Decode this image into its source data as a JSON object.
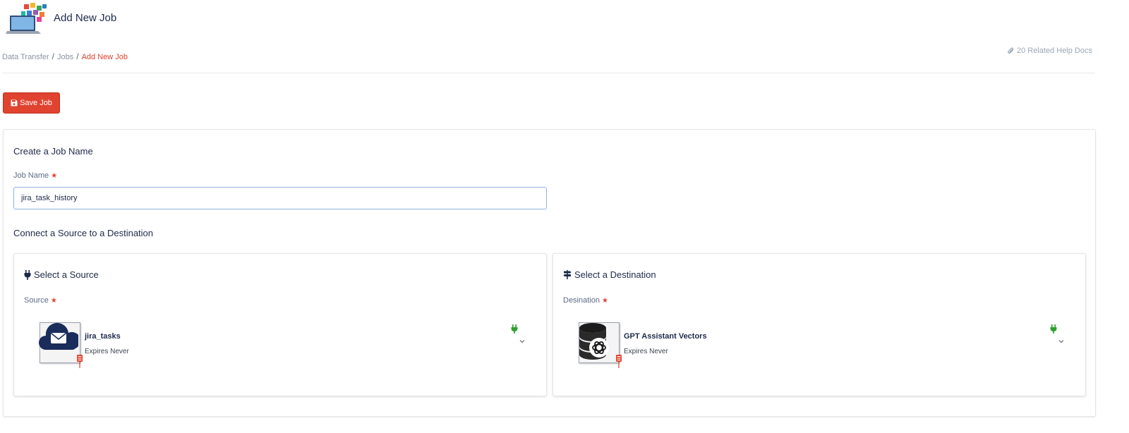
{
  "header": {
    "title": "Add New Job",
    "logo_icon": "laptop-apps-icon"
  },
  "breadcrumb": {
    "items": [
      "Data Transfer",
      "Jobs"
    ],
    "current": "Add New Job",
    "separator": "/"
  },
  "help": {
    "label": "20 Related Help Docs",
    "icon": "paperclip-icon"
  },
  "toolbar": {
    "save_label": "Save Job",
    "save_icon": "floppy-disk-icon"
  },
  "form": {
    "section_title": "Create a Job Name",
    "job_name_label": "Job Name",
    "job_name_value": "jira_task_history",
    "connect_title": "Connect a Source to a Destination"
  },
  "source": {
    "title": "Select a Source",
    "icon": "plug-icon",
    "label": "Source",
    "connector_name": "jira_tasks",
    "expires": "Expires Never",
    "thumb_icon": "cloud-envelope-icon"
  },
  "destination": {
    "title": "Select a Destination",
    "icon": "signpost-icon",
    "label": "Desination",
    "connector_name": "GPT Assistant Vectors",
    "expires": "Expires Never",
    "thumb_icon": "database-openai-icon"
  },
  "required_marker": "★",
  "colors": {
    "accent": "#e0432f",
    "text": "#1e2a4a",
    "status_green": "#2ea02e",
    "input_border": "#8fb2e2"
  }
}
